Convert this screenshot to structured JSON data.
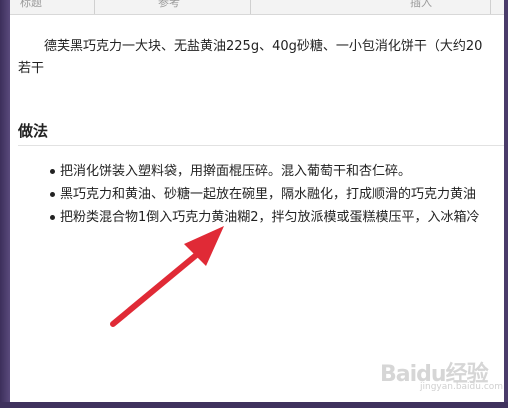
{
  "table_header": {
    "col1": "标题",
    "col2": "参考",
    "col3": "插入"
  },
  "ingredients": {
    "line1": "德芙黑巧克力一大块、无盐黄油225g、40g砂糖、一小包消化饼干（大约20",
    "line2": "若干"
  },
  "method": {
    "title": "做法",
    "steps": [
      "把消化饼装入塑料袋，用擀面棍压碎。混入葡萄干和杏仁碎。",
      "黑巧克力和黄油、砂糖一起放在碗里，隔水融化，打成顺滑的巧克力黄油",
      "把粉类混合物1倒入巧克力黄油糊2，拌匀放派模或蛋糕模压平，入冰箱冷"
    ]
  },
  "watermark": {
    "brand": "Baidu经验",
    "url": "jingyan.baidu.com"
  },
  "colors": {
    "frame": "#4d3f6d",
    "arrow": "#e02a36",
    "text": "#222222"
  }
}
